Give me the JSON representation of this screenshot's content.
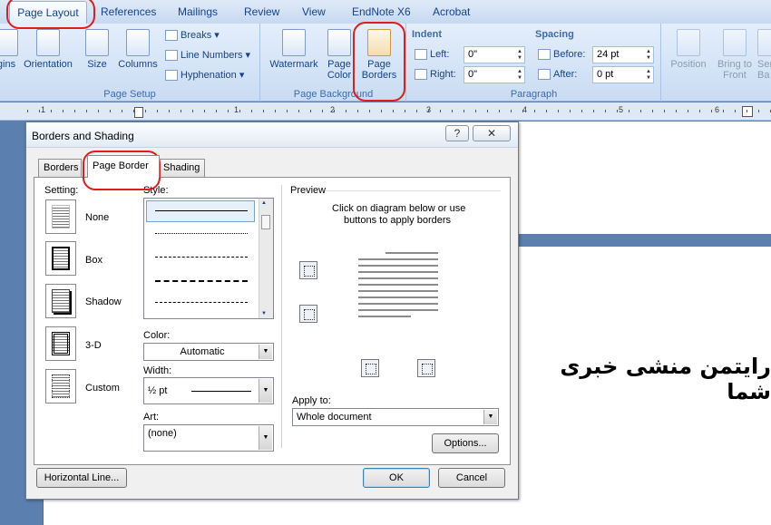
{
  "ribbon": {
    "tabs": [
      {
        "label": "Page Layout"
      },
      {
        "label": "References"
      },
      {
        "label": "Mailings"
      },
      {
        "label": "Review"
      },
      {
        "label": "View"
      },
      {
        "label": "EndNote X6"
      },
      {
        "label": "Acrobat"
      }
    ],
    "page_setup": {
      "margins": "gins",
      "orientation": "Orientation",
      "size": "Size",
      "columns": "Columns",
      "breaks": "Breaks",
      "line_numbers": "Line Numbers",
      "hyphenation": "Hyphenation",
      "group_label": "Page Setup"
    },
    "page_background": {
      "watermark": "Watermark",
      "page_color_1": "Page",
      "page_color_2": "Color",
      "page_borders_1": "Page",
      "page_borders_2": "Borders",
      "group_label": "Page Background"
    },
    "paragraph": {
      "indent_label": "Indent",
      "left_label": "Left:",
      "left_value": "0\"",
      "right_label": "Right:",
      "right_value": "0\"",
      "spacing_label": "Spacing",
      "before_label": "Before:",
      "before_value": "24 pt",
      "after_label": "After:",
      "after_value": "0 pt",
      "group_label": "Paragraph"
    },
    "arrange": {
      "position": "Position",
      "bring_to_front_1": "Bring to",
      "bring_to_front_2": "Front",
      "send_1": "Sen",
      "send_2": "Ba"
    }
  },
  "ruler": {
    "numbers": [
      "1",
      "1",
      "2",
      "3",
      "4",
      "5",
      "6"
    ]
  },
  "document": {
    "text": "رایتمن منشی خبری شما"
  },
  "dialog": {
    "title": "Borders and Shading",
    "help_button": "?",
    "close_button": "✕",
    "tabs": [
      {
        "label": "Borders"
      },
      {
        "label": "Page Border"
      },
      {
        "label": "Shading"
      }
    ],
    "setting_label": "Setting:",
    "settings": [
      {
        "label": "None"
      },
      {
        "label": "Box"
      },
      {
        "label": "Shadow"
      },
      {
        "label": "3-D"
      },
      {
        "label": "Custom"
      }
    ],
    "style_label": "Style:",
    "color_label": "Color:",
    "color_value": "Automatic",
    "width_label": "Width:",
    "width_value": "½ pt",
    "art_label": "Art:",
    "art_value": "(none)",
    "preview_label": "Preview",
    "preview_hint_1": "Click on diagram below or use",
    "preview_hint_2": "buttons to apply borders",
    "apply_to_label": "Apply to:",
    "apply_to_value": "Whole document",
    "options_button": "Options...",
    "horizontal_line_button": "Horizontal Line...",
    "ok_button": "OK",
    "cancel_button": "Cancel"
  }
}
